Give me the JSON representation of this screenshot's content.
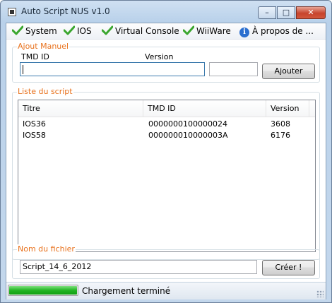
{
  "window": {
    "title": "Auto Script NUS v1.0",
    "min_glyph": "–",
    "max_glyph": "□",
    "close_glyph": "✕"
  },
  "menu": [
    {
      "label": "System",
      "icon": "checkmark-icon"
    },
    {
      "label": "IOS",
      "icon": "checkmark-icon"
    },
    {
      "label": "Virtual Console",
      "icon": "checkmark-icon"
    },
    {
      "label": "WiiWare",
      "icon": "checkmark-icon"
    },
    {
      "label": "À propos de ...",
      "icon": "info-icon"
    }
  ],
  "manual": {
    "group_title": "Ajout Manuel",
    "tmd_label": "TMD ID",
    "version_label": "Version",
    "tmd_value": "",
    "version_value": "",
    "add_button": "Ajouter"
  },
  "script": {
    "group_title": "Liste du script",
    "columns": [
      "Titre",
      "TMD ID",
      "Version"
    ],
    "rows": [
      [
        "IOS36",
        "0000000100000024",
        "3608"
      ],
      [
        "IOS58",
        "000000010000003A",
        "6176"
      ]
    ]
  },
  "file": {
    "group_title": "Nom du fichier",
    "value": "Script_14_6_2012",
    "create_button": "Créer !"
  },
  "status": {
    "progress": 1.0,
    "text": "Chargement terminé"
  },
  "colors": {
    "accent_group_title": "#e8711c",
    "progress": "#23b523",
    "close_button": "#c7442d"
  }
}
